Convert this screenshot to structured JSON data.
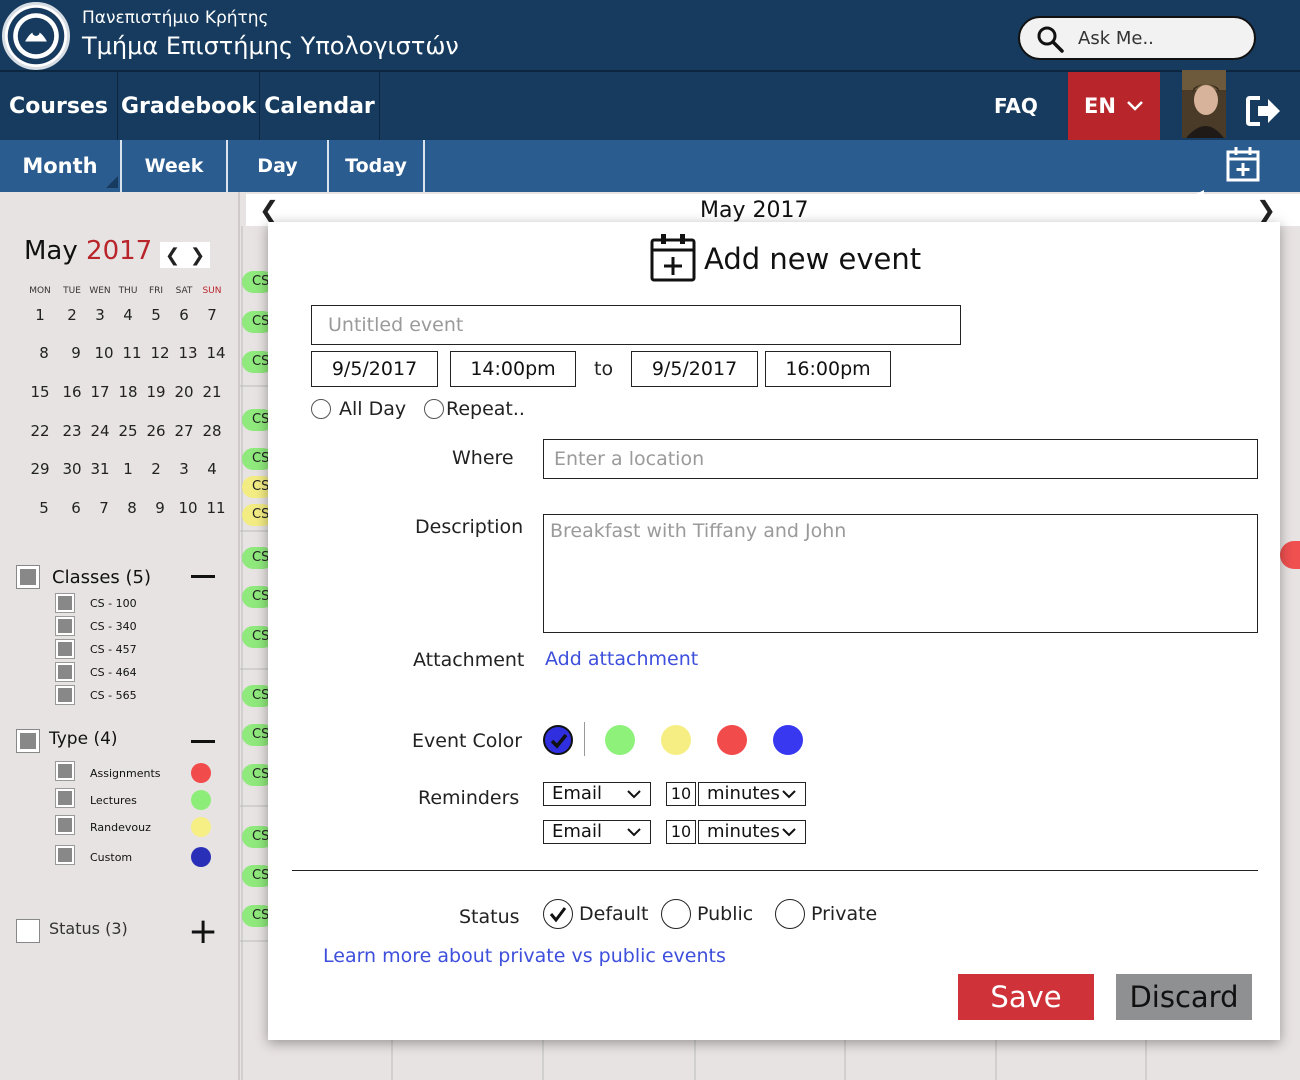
{
  "header": {
    "university": "Πανεπιστήμιο Κρήτης",
    "department": "Τμήμα Επιστήμης Υπολογιστών",
    "search_placeholder": "Ask Me.."
  },
  "mainnav": {
    "items": [
      "Courses",
      "Gradebook",
      "Calendar"
    ],
    "faq": "FAQ",
    "language": "EN"
  },
  "subnav": {
    "items": [
      "Month",
      "Week",
      "Day",
      "Today"
    ],
    "active": "Month"
  },
  "calendar": {
    "title": "May 2017",
    "weekday_first": "MO"
  },
  "mini_calendar": {
    "month": "May",
    "year": "2017",
    "weekdays": [
      "MON",
      "TUE",
      "WEN",
      "THU",
      "FRI",
      "SAT",
      "SUN"
    ],
    "weeks": [
      [
        "1",
        "2",
        "3",
        "4",
        "5",
        "6",
        "7"
      ],
      [
        "8",
        "9",
        "10",
        "11",
        "12",
        "13",
        "14"
      ],
      [
        "15",
        "16",
        "17",
        "18",
        "19",
        "20",
        "21"
      ],
      [
        "22",
        "23",
        "24",
        "25",
        "26",
        "27",
        "28"
      ],
      [
        "29",
        "30",
        "31",
        "1",
        "2",
        "3",
        "4"
      ],
      [
        "5",
        "6",
        "7",
        "8",
        "9",
        "10",
        "11"
      ]
    ]
  },
  "filters": {
    "classes": {
      "title": "Classes (5)",
      "items": [
        "CS - 100",
        "CS - 340",
        "CS - 457",
        "CS - 464",
        "CS - 565"
      ]
    },
    "type": {
      "title": "Type (4)",
      "items": [
        {
          "label": "Assignments",
          "color": "#f24b4b"
        },
        {
          "label": "Lectures",
          "color": "#8ded79"
        },
        {
          "label": "Randevouz",
          "color": "#f5ef86"
        },
        {
          "label": "Custom",
          "color": "#2a2fb8"
        }
      ]
    },
    "status": {
      "title": "Status (3)"
    }
  },
  "event_chip_label": "CS",
  "modal": {
    "title": "Add new event",
    "event_title_placeholder": "Untitled event",
    "start_date": "9/5/2017",
    "start_time": "14:00pm",
    "to_label": "to",
    "end_date": "9/5/2017",
    "end_time": "16:00pm",
    "all_day_label": "All Day",
    "repeat_label": "Repeat..",
    "where_label": "Where",
    "where_placeholder": "Enter a location",
    "description_label": "Description",
    "description_placeholder": "Breakfast with Tiffany and John",
    "attachment_label": "Attachment",
    "attachment_link": "Add attachment",
    "event_color_label": "Event Color",
    "colors": [
      "#2f2fe0",
      "#8ef27a",
      "#f7ee83",
      "#f24b4b",
      "#3838f0"
    ],
    "selected_color": "#2f2fe0",
    "reminders_label": "Reminders",
    "reminders": [
      {
        "method": "Email",
        "amount": "10",
        "unit": "minutes"
      },
      {
        "method": "Email",
        "amount": "10",
        "unit": "minutes"
      }
    ],
    "status_label": "Status",
    "status_options": [
      "Default",
      "Public",
      "Private"
    ],
    "status_selected": "Default",
    "learn_more_link": "Learn more about private vs public events",
    "save_label": "Save",
    "discard_label": "Discard"
  },
  "colors": {
    "header_bg": "#163b5e",
    "subnav_bg": "#2b5c8f",
    "accent_red": "#b8262c",
    "save_bg": "#cf3239",
    "discard_bg": "#8f9091",
    "link": "#3d4fdc"
  }
}
